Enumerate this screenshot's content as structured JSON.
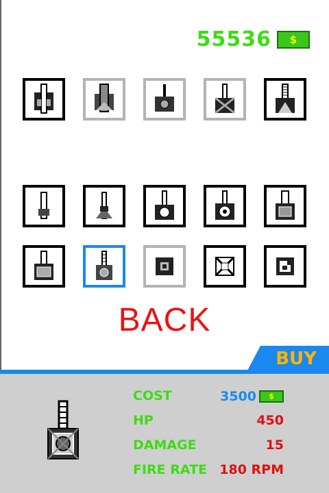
{
  "currency": {
    "amount": "55536",
    "symbol": "$"
  },
  "slots": [
    {
      "item": "tower-1",
      "state": "owned"
    },
    {
      "item": "tower-2",
      "state": "locked"
    },
    {
      "item": "tower-3",
      "state": "locked"
    },
    {
      "item": "tower-4",
      "state": "locked"
    },
    {
      "item": "tower-5",
      "state": "owned"
    },
    {
      "item": "tower-6",
      "state": "owned"
    },
    {
      "item": "tower-7",
      "state": "owned"
    },
    {
      "item": "tower-8",
      "state": "owned"
    },
    {
      "item": "tower-9",
      "state": "owned"
    },
    {
      "item": "tower-10",
      "state": "owned"
    },
    {
      "item": "tower-11",
      "state": "owned"
    },
    {
      "item": "tower-12",
      "state": "selected"
    },
    {
      "item": "tower-13",
      "state": "locked"
    },
    {
      "item": "tower-14",
      "state": "owned"
    },
    {
      "item": "tower-15",
      "state": "owned"
    }
  ],
  "back_label": "BACK",
  "buy_label": "BUY",
  "stats": {
    "cost_label": "COST",
    "cost_value": "3500",
    "hp_label": "HP",
    "hp_value": "450",
    "damage_label": "DAMAGE",
    "damage_value": "15",
    "fire_rate_label": "FIRE RATE",
    "fire_rate_value": "180 RPM"
  },
  "colors": {
    "money_green": "#3ddc14",
    "accent_blue": "#1a88ee",
    "back_red": "#ee1111",
    "buy_orange": "#ffb400",
    "value_red": "#e01010"
  }
}
